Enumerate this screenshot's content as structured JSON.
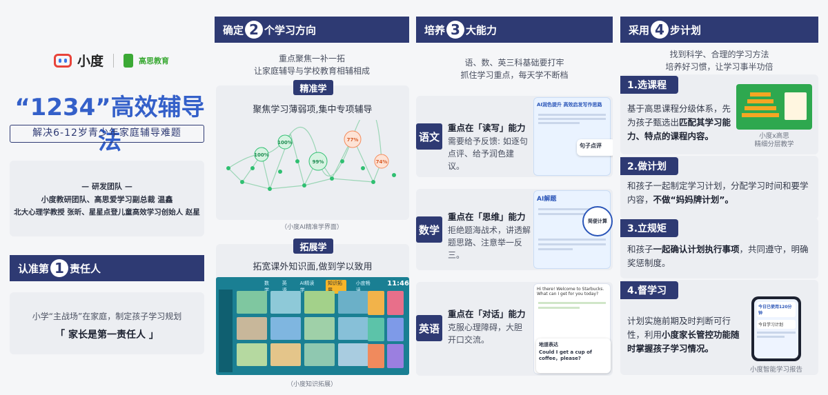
{
  "brand": {
    "xiaodu": "小度",
    "gaosi": "高思教育"
  },
  "hero": {
    "title": "“1234”高效辅导法",
    "subtitle": "解决6-12岁青少年家庭辅导难题"
  },
  "team": {
    "heading": "— 研发团队 —",
    "line1": "小度教研团队、高思爱学习副总裁 温鑫",
    "line2": "北大心理学教授 张昕、星星点登儿童高效学习创始人 赵星"
  },
  "col1": {
    "pre": "认准第",
    "num": "1",
    "post": "责任人",
    "text": "小学“主战场”在家庭，制定孩子学习规划",
    "quote": "「 家长是第一责任人 」"
  },
  "col2": {
    "pre": "确定",
    "num": "2",
    "post": "个学习方向",
    "sub1": "重点聚焦一补一拓",
    "sub2": "让家庭辅导与学校教育相辅相成",
    "tag1": "精准学",
    "desc1": "聚焦学习薄弱项,集中专项辅导",
    "cap1": "（小度AI精准学界面）",
    "map_pcts": [
      "100%",
      "100%",
      "99%",
      "77%",
      "74%"
    ],
    "tag2": "拓展学",
    "desc2": "拓宽课外知识面,做到学以致用",
    "cap2": "（小度知识拓展）",
    "tablet_tabs": [
      "数学",
      "英语",
      "AI精读学",
      "知识拓展",
      "小度畅读"
    ],
    "tablet_time": "11:46"
  },
  "col3": {
    "pre": "培养",
    "num": "3",
    "post": "大能力",
    "sub1": "语、数、英三科基础要打牢",
    "sub2": "抓住学习重点，每天学不断档",
    "subjects": [
      {
        "name": "语文",
        "head": "重点在「读写」能力",
        "body": "需要给予反馈: 如逐句点评、给予润色建议。",
        "mock_title": "AI润色提升  高效启发写作思路",
        "bubble": "句子点评"
      },
      {
        "name": "数学",
        "head": "重点在「思维」能力",
        "body": "拒绝题海战术，讲透解题思路、注意举一反三。",
        "mock_title": "AI解题",
        "bubble": "简便计算"
      },
      {
        "name": "英语",
        "head": "重点在「对话」能力",
        "body": "克服心理障碍，大胆开口交流。",
        "mock_title": "Hi there! Welcome to Starbucks. What can I get for you today?",
        "bubble_title": "地道表达",
        "bubble": "Could I get a cup of coffee，please?"
      }
    ]
  },
  "col4": {
    "pre": "采用",
    "num": "4",
    "post": "步计划",
    "sub1": "找到科学、合理的学习方法",
    "sub2": "培养好习惯，让学习事半功倍",
    "steps": [
      {
        "title": "1.选课程",
        "t1": "基于高思课程分级体系，先为孩子甄选出",
        "b1": "匹配其学习能力、特点的课程内容。",
        "cap": "小度x高思\n精细分层教学"
      },
      {
        "title": "2.做计划",
        "t1": "和孩子一起制定学习计划，分配学习时间和要学内容，",
        "b1": "不做“妈妈牌计划”。"
      },
      {
        "title": "3.立规矩",
        "t1": "和孩子",
        "b1": "一起确认计划执行事项",
        "t2": "，共同遵守，明确奖惩制度。"
      },
      {
        "title": "4.督学习",
        "t1": "计划实施前期及时判断可行性，利用",
        "b1": "小度家长管控功能随时掌握孩子学习情况。",
        "cap": "小度智能学习报告",
        "phone1": "今日已使用120分钟",
        "phone2": "今日学习计划"
      }
    ]
  }
}
